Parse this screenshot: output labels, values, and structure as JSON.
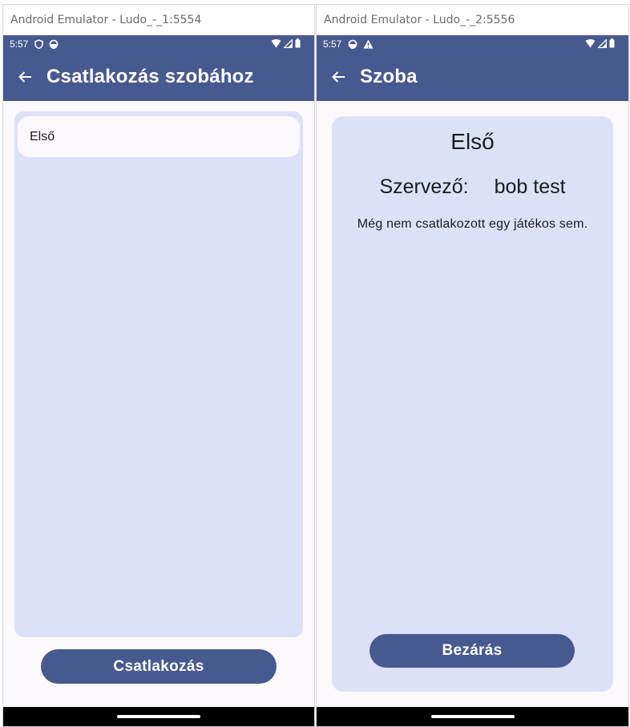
{
  "window1": {
    "title": "Android Emulator - Ludo_-_1:5554",
    "status": {
      "time": "5:57"
    },
    "appbar": {
      "title": "Csatlakozás szobához"
    },
    "rooms": [
      "Első"
    ],
    "join_button": "Csatlakozás"
  },
  "window2": {
    "title": "Android Emulator - Ludo_-_2:5556",
    "status": {
      "time": "5:57"
    },
    "appbar": {
      "title": "Szoba"
    },
    "room": {
      "name": "Első",
      "organizer_label": "Szervező:",
      "organizer_name": "bob test",
      "players_message": "Még nem csatlakozott egy játékos sem."
    },
    "close_button": "Bezárás"
  },
  "colors": {
    "primary": "#475a8f",
    "surface": "#fcf9fe",
    "container": "#dde1f8",
    "on_surface": "#1b1b21"
  },
  "icons": {
    "window1_status": [
      "shield-icon",
      "vpn-circle-icon",
      "wifi-icon",
      "signal-icon",
      "battery-icon"
    ],
    "window2_status": [
      "vpn-circle-icon",
      "warning-icon",
      "wifi-icon",
      "signal-icon",
      "battery-icon"
    ],
    "back": "arrow-back-icon"
  }
}
